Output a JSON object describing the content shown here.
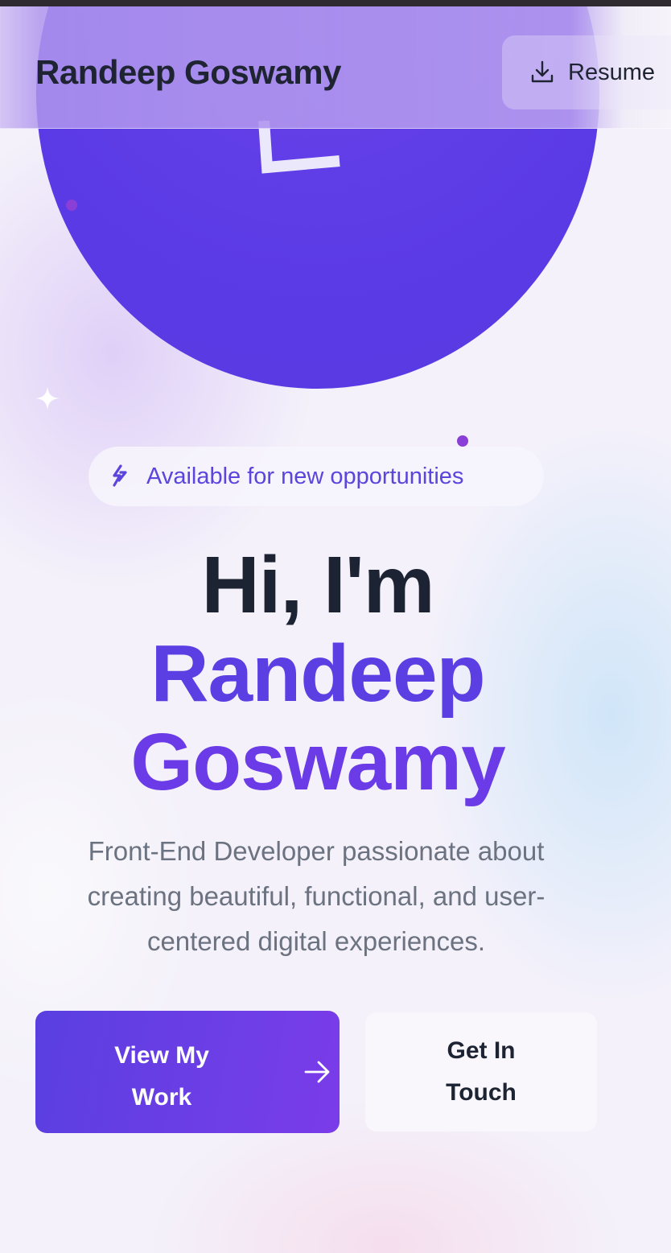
{
  "header": {
    "brand": "Randeep Goswamy",
    "resume_label": "Resume",
    "resume_icon": "download-icon"
  },
  "hero": {
    "badge_text": "Available for new opportunities",
    "badge_icon": "sparkle-hand-icon",
    "greeting": "Hi, I'm",
    "name_first": "Randeep",
    "name_last": "Goswamy",
    "tagline": "Front-End Developer passionate about creating beautiful, functional, and user-centered digital experiences."
  },
  "actions": {
    "primary_label": "View My Work",
    "primary_icon": "arrow-right-icon",
    "secondary_label": "Get In Touch"
  },
  "colors": {
    "accent": "#5b3fe2",
    "accent_purple": "#6a3be6",
    "text_dark": "#1c2433",
    "text_muted": "#6b7280"
  }
}
